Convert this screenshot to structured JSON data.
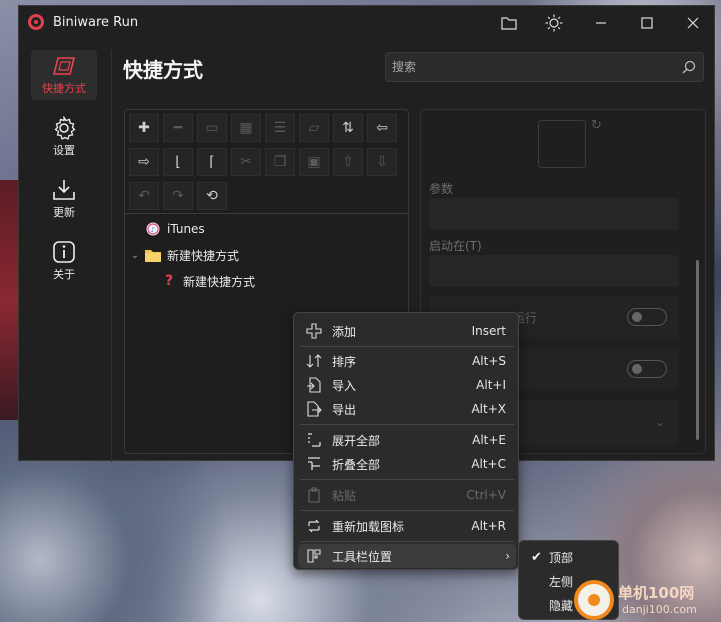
{
  "app": {
    "title": "Biniware Run"
  },
  "nav": {
    "items": [
      {
        "label": "快捷方式",
        "icon": "shortcut-icon"
      },
      {
        "label": "设置",
        "icon": "gear-icon"
      },
      {
        "label": "更新",
        "icon": "download-icon"
      },
      {
        "label": "关于",
        "icon": "info-icon"
      }
    ]
  },
  "page": {
    "title": "快捷方式"
  },
  "search": {
    "placeholder": "搜索"
  },
  "tree": {
    "items": [
      {
        "label": "iTunes",
        "icon": "itunes-icon"
      },
      {
        "label": "新建快捷方式",
        "icon": "folder-icon"
      },
      {
        "label": "新建快捷方式",
        "icon": "question-icon"
      }
    ]
  },
  "details": {
    "params_label": "参数",
    "start_in_label": "启动在(T)",
    "admin_label": "以管理员身份运行"
  },
  "context_menu": {
    "items": [
      {
        "label": "添加",
        "shortcut": "Insert"
      },
      {
        "label": "排序",
        "shortcut": "Alt+S"
      },
      {
        "label": "导入",
        "shortcut": "Alt+I"
      },
      {
        "label": "导出",
        "shortcut": "Alt+X"
      },
      {
        "label": "展开全部",
        "shortcut": "Alt+E"
      },
      {
        "label": "折叠全部",
        "shortcut": "Alt+C"
      },
      {
        "label": "粘贴",
        "shortcut": "Ctrl+V"
      },
      {
        "label": "重新加载图标",
        "shortcut": "Alt+R"
      },
      {
        "label": "工具栏位置",
        "shortcut": ""
      }
    ],
    "submenu": [
      {
        "label": "顶部",
        "checked": true
      },
      {
        "label": "左侧",
        "checked": false
      },
      {
        "label": "隐藏",
        "checked": false
      }
    ]
  },
  "watermark": {
    "text": "单机100网",
    "sub": "danji100.com"
  },
  "colors": {
    "accent": "#e8434f",
    "window_bg": "#202020",
    "menu_bg": "#2b2b2b"
  }
}
